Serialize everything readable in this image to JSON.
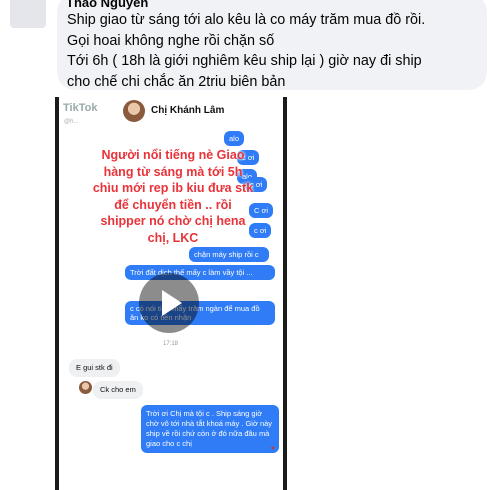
{
  "comment": {
    "author": "Thảo Nguyễn",
    "lines": [
      "Ship giao từ sáng tới alo kêu là co máy trăm mua đồ rồi.",
      "Gọi hoai không nghe rồi chặn số",
      "Tới 6h ( 18h là giới nghiêm kêu ship lại ) giờ nay đi ship",
      "cho chế chi chắc ăn 2triu biên bản"
    ]
  },
  "video": {
    "brand": "TikTok",
    "user_id": "@h...",
    "contact_name": "Chị Khánh Lâm",
    "overlay_text": "Người nổi tiếng nè Giao hàng từ sáng mà tới 5h chìu mới rep ib kiu đưa stk để chuyển tiền .. rồi shipper nó chờ chị hena chị, LKC",
    "messages": {
      "m1": "alo",
      "m2": "c ơi",
      "m3": "alo",
      "m4": "c ơi",
      "m5": "C ơi",
      "m6": "c ơi",
      "m7": "chặn máy ship   rồi c",
      "m8": "Trời đất dịch thế mấy c làm vầy tội ...",
      "m9": "c có nói tiền mấy trăm ngàn để mua đồ ăn ko có tiền nhận",
      "timestamp": "17:18",
      "m10": "E gui stk đi",
      "m11": "Ck cho em",
      "m12": "Trời ơi Chị mà tội c . Ship sáng giờ chờ vô tới nhà tắt khoá máy . Giờ này ship về rồi chứ còn ở đó nữa đâu mà giao cho c chị"
    }
  }
}
